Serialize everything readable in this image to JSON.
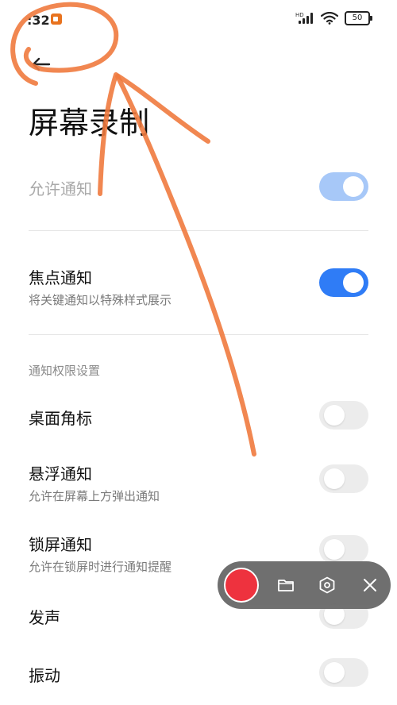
{
  "status_bar": {
    "time": ":32",
    "network_label": "HD",
    "battery": "50"
  },
  "header": {
    "title": "屏幕录制"
  },
  "settings": {
    "allow_notifications": {
      "label": "允许通知",
      "enabled": true,
      "dimmed": true
    },
    "focus_notifications": {
      "label": "焦点通知",
      "description": "将关键通知以特殊样式展示",
      "enabled": true
    },
    "permissions_section": "通知权限设置",
    "desktop_badge": {
      "label": "桌面角标",
      "enabled": false
    },
    "floating_notifications": {
      "label": "悬浮通知",
      "description": "允许在屏幕上方弹出通知",
      "enabled": false
    },
    "lockscreen_notifications": {
      "label": "锁屏通知",
      "description": "允许在锁屏时进行通知提醒",
      "enabled": false
    },
    "sound": {
      "label": "发声",
      "enabled": false
    },
    "vibration": {
      "label": "振动",
      "enabled": false
    }
  },
  "recorder_controls": {
    "icons": [
      "record-icon",
      "folder-icon",
      "settings-hex-icon",
      "close-icon"
    ]
  },
  "colors": {
    "accent": "#2f7cf6",
    "accent_dim": "#a7c8f8",
    "toggle_off": "#ececec",
    "record_red": "#ee2a37",
    "annotation": "#f07a3e"
  }
}
